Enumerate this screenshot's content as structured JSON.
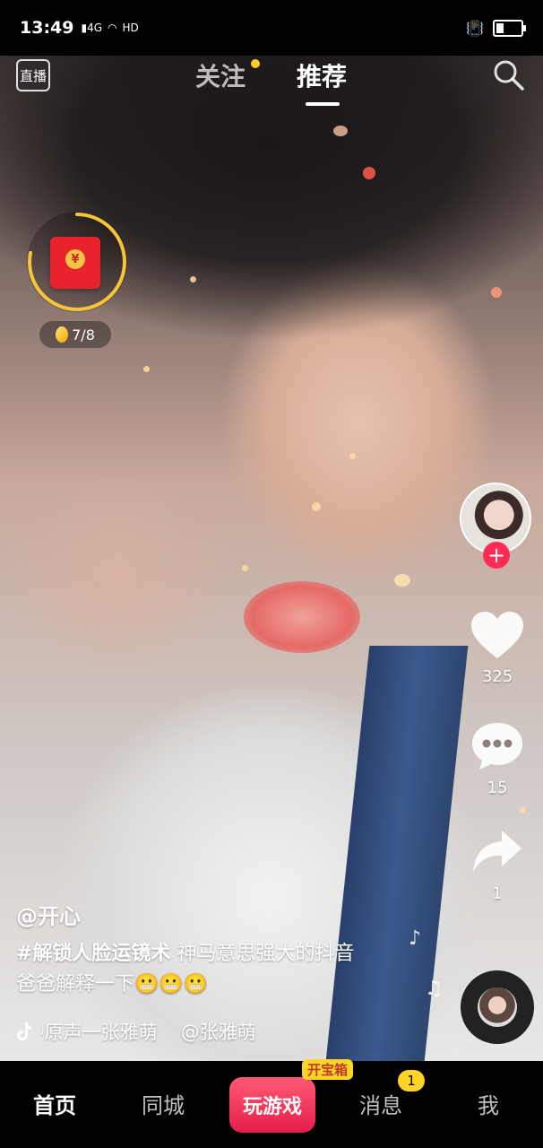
{
  "status_bar": {
    "time": "13:49",
    "signal": "4G",
    "hd": "HD"
  },
  "top_nav": {
    "live_label": "直播",
    "tab_following": "关注",
    "tab_for_you": "推荐"
  },
  "red_envelope": {
    "seal": "¥",
    "progress_text": "7/8",
    "ring_progress": 0.78
  },
  "right_rail": {
    "likes": "325",
    "comments": "15",
    "shares": "1"
  },
  "caption": {
    "author": "@开心",
    "hashtag": "#解锁人脸运镜术",
    "text_line1": "神马意思强大的抖音",
    "text_line2": "爸爸解释一下😬😬😬",
    "sound": "ʲ原声一张雅萌",
    "sound_author": "@张雅萌"
  },
  "bottom_tabs": {
    "home": "首页",
    "city": "同城",
    "play_games": "玩游戏",
    "chest_badge": "开宝箱",
    "messages": "消息",
    "messages_badge": "1",
    "me": "我"
  },
  "colors": {
    "accent": "#fe2c55",
    "badge": "#ffd426"
  }
}
